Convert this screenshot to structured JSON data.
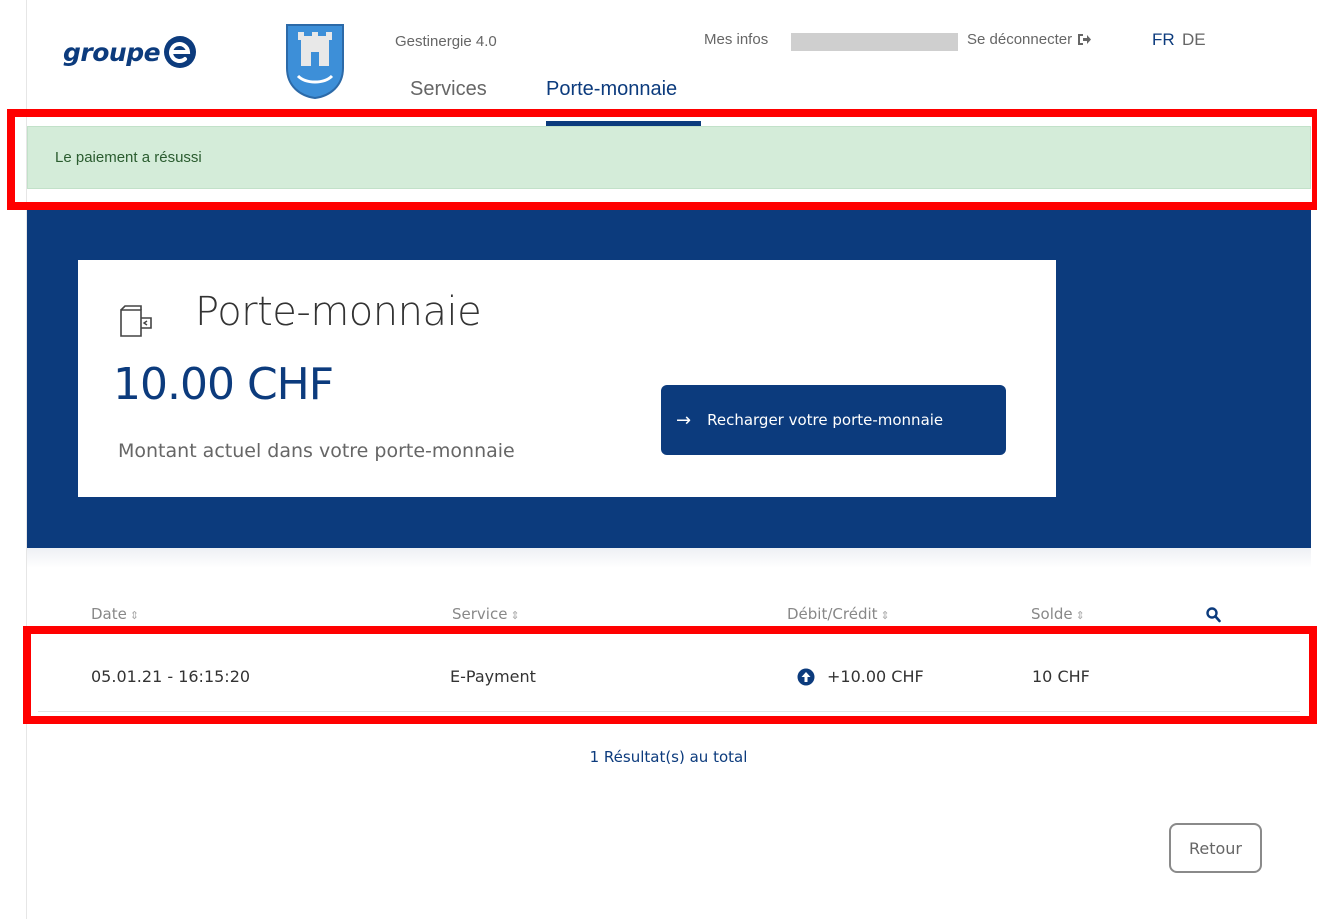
{
  "header": {
    "logo_text": "groupe",
    "app_name": "Gestinergie 4.0",
    "nav": {
      "services": "Services",
      "porte_monnaie": "Porte-monnaie"
    },
    "mes_infos": "Mes infos",
    "logout": "Se déconnecter",
    "languages": {
      "fr": "FR",
      "de": "DE"
    }
  },
  "alert": {
    "message": "Le paiement a résussi"
  },
  "wallet": {
    "title": "Porte-monnaie",
    "balance": "10.00 CHF",
    "subtitle": "Montant actuel dans votre porte-monnaie",
    "recharge_label": "Recharger votre porte-monnaie"
  },
  "table": {
    "headers": {
      "date": "Date",
      "service": "Service",
      "debit_credit": "Débit/Crédit",
      "solde": "Solde"
    },
    "rows": [
      {
        "date": "05.01.21 - 16:15:20",
        "service": "E-Payment",
        "amount": "+10.00 CHF",
        "solde": "10 CHF"
      }
    ],
    "total": "1 Résultat(s) au total"
  },
  "footer": {
    "back_label": "Retour"
  },
  "colors": {
    "brand": "#0c3b7d",
    "success_bg": "#d4ecd9",
    "highlight": "#ff0000"
  }
}
